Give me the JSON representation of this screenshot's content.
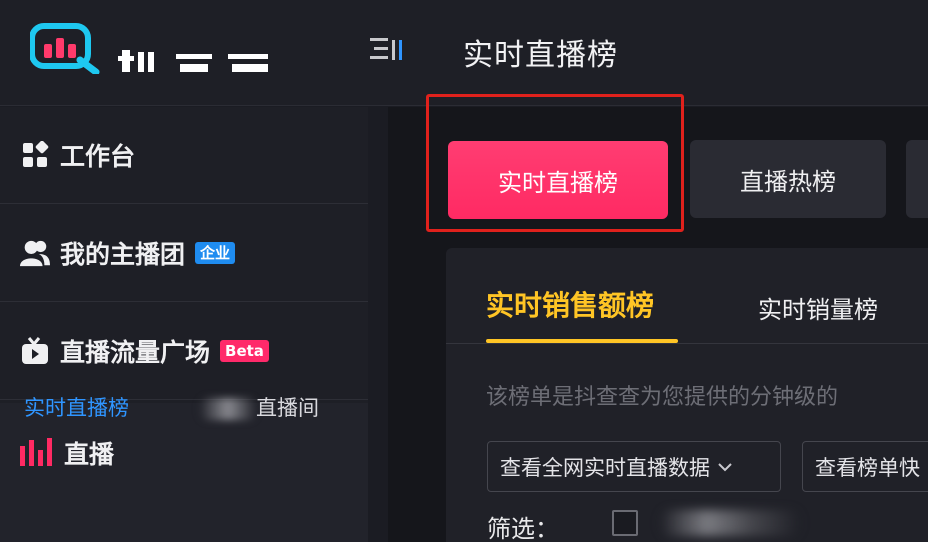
{
  "header": {
    "title": "实时直播榜",
    "brand_color": "#1ec8f0",
    "icons": {
      "logo": "douchacha-logo-icon",
      "menu": "menu-collapse-icon"
    }
  },
  "sidebar": {
    "items": [
      {
        "label": "工作台",
        "icon": "workbench-grid-icon"
      },
      {
        "label": "我的主播团",
        "icon": "users-icon",
        "badge": "企业",
        "badge_color": "#1f8cf0"
      },
      {
        "label": "直播流量广场",
        "icon": "tv-icon",
        "badge": "Beta",
        "badge_color": "#ff2a6a"
      },
      {
        "label": "直播",
        "icon": "bar-chart-icon"
      }
    ],
    "sub_links": [
      {
        "label": "实时直播榜",
        "active": true
      },
      {
        "label": "直播间",
        "active": false
      }
    ]
  },
  "tabs": [
    {
      "label": "实时直播榜",
      "active": true
    },
    {
      "label": "直播热榜",
      "active": false
    }
  ],
  "ranking": {
    "tabs": [
      {
        "label": "实时销售额榜",
        "active": true
      },
      {
        "label": "实时销量榜",
        "active": false
      }
    ],
    "description": "该榜单是抖查查为您提供的分钟级的",
    "selects": [
      {
        "value": "查看全网实时直播数据"
      },
      {
        "value": "查看榜单快"
      }
    ],
    "filter_label": "筛选："
  },
  "colors": {
    "accent_pink": "#ff2a63",
    "accent_yellow": "#ffc525",
    "highlight_red": "#e0211c",
    "active_link_blue": "#2f95ff"
  }
}
